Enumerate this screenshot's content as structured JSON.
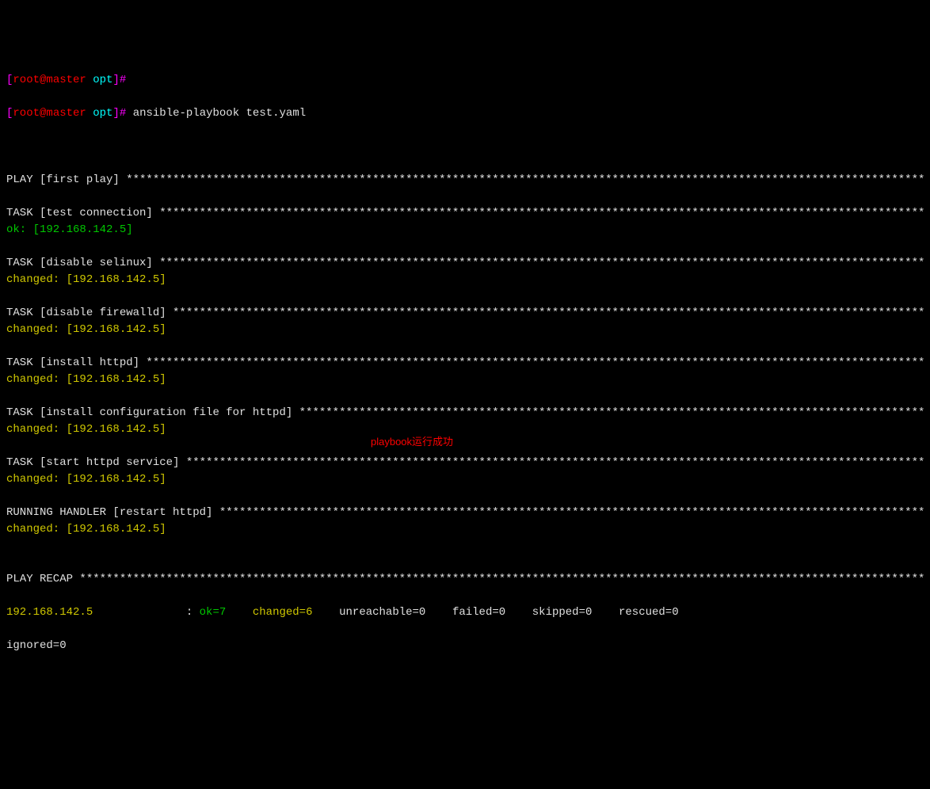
{
  "prompt": {
    "user": "root",
    "at": "@",
    "host": "master",
    "path": "opt",
    "bracket_open": "[",
    "bracket_close": "]",
    "hash": "#",
    "command": "ansible-playbook test.yaml"
  },
  "blocks": [
    {
      "header": "PLAY [first play] ",
      "results": []
    },
    {
      "header": "TASK [test connection] ",
      "results": [
        {
          "status": "ok",
          "host": "[192.168.142.5]",
          "color": "green"
        }
      ]
    },
    {
      "header": "TASK [disable selinux] ",
      "results": [
        {
          "status": "changed",
          "host": "[192.168.142.5]",
          "color": "yellow"
        }
      ]
    },
    {
      "header": "TASK [disable firewalld] ",
      "results": [
        {
          "status": "changed",
          "host": "[192.168.142.5]",
          "color": "yellow"
        }
      ]
    },
    {
      "header": "TASK [install httpd] ",
      "results": [
        {
          "status": "changed",
          "host": "[192.168.142.5]",
          "color": "yellow"
        }
      ]
    },
    {
      "header": "TASK [install configuration file for httpd] ",
      "results": [
        {
          "status": "changed",
          "host": "[192.168.142.5]",
          "color": "yellow"
        }
      ]
    },
    {
      "header": "TASK [start httpd service] ",
      "results": [
        {
          "status": "changed",
          "host": "[192.168.142.5]",
          "color": "yellow"
        }
      ]
    },
    {
      "header": "RUNNING HANDLER [restart httpd] ",
      "results": [
        {
          "status": "changed",
          "host": "[192.168.142.5]",
          "color": "yellow"
        }
      ]
    }
  ],
  "recap": {
    "header": "PLAY RECAP ",
    "host": "192.168.142.5",
    "colon": " : ",
    "ok": "ok=7",
    "changed": "changed=6",
    "unreachable": "unreachable=0",
    "failed": "failed=0",
    "skipped": "skipped=0",
    "rescued": "rescued=0",
    "ignored": "ignored=0"
  },
  "annotation": "playbook运行成功",
  "truncated_top": "[root@master opt]#"
}
